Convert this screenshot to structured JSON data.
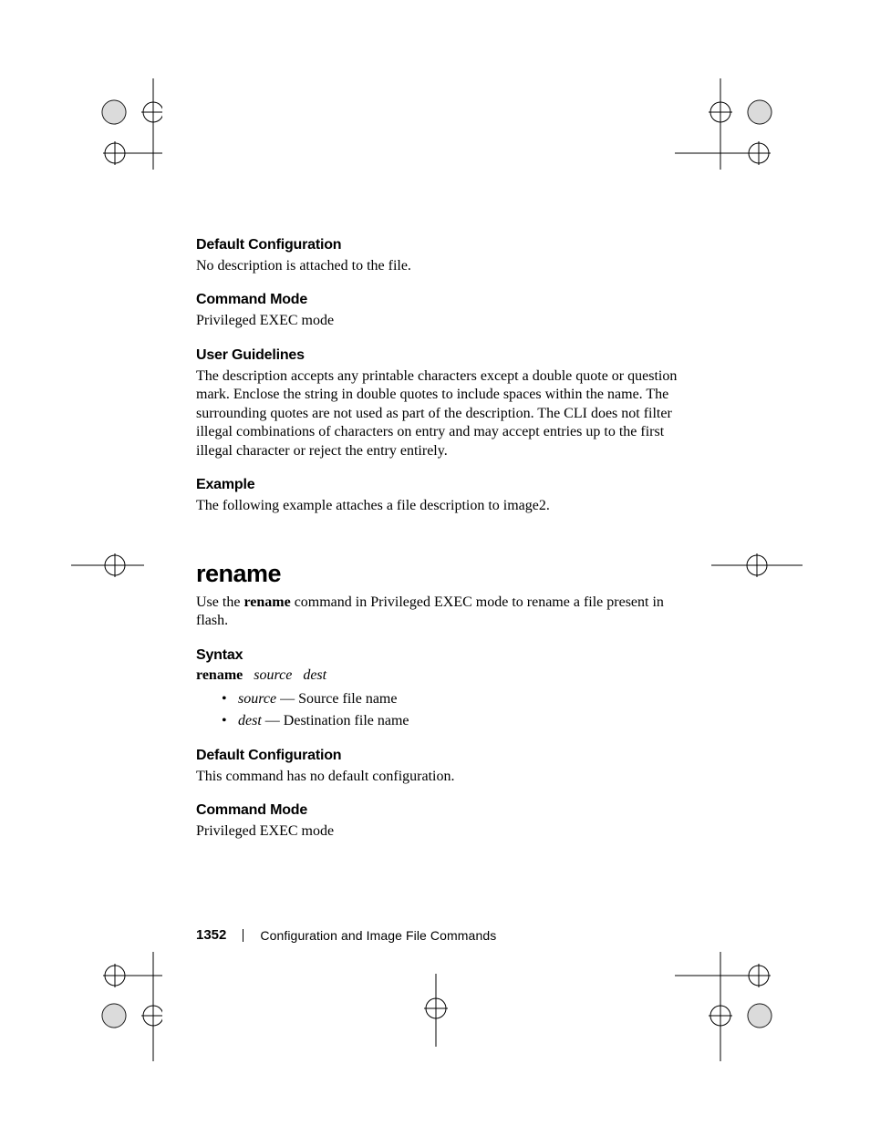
{
  "sections": {
    "defcfg1_h": "Default Configuration",
    "defcfg1_b": "No description is attached to the file.",
    "cmdmode1_h": "Command Mode",
    "cmdmode1_b": "Privileged EXEC mode",
    "userguide_h": "User Guidelines",
    "userguide_b": "The description accepts any printable characters except a double quote or question mark. Enclose the string in double quotes to include spaces within the name. The surrounding quotes are not used as part of the description. The CLI does not filter illegal combinations of characters on entry and may accept entries up to the first illegal character or reject the entry entirely.",
    "example_h": "Example",
    "example_b": "The following example attaches a file description to image2."
  },
  "rename": {
    "title": "rename",
    "intro_pre": "Use the ",
    "intro_cmd": "rename",
    "intro_post": " command in Privileged EXEC mode to rename a file present in flash.",
    "syntax_h": "Syntax",
    "syntax_cmd": "rename",
    "syntax_arg1": "source",
    "syntax_arg2": "dest",
    "bullet1_arg": "source",
    "bullet1_desc": " — Source file name",
    "bullet2_arg": "dest",
    "bullet2_desc": " — Destination file name",
    "defcfg_h": "Default Configuration",
    "defcfg_b": "This command has no default configuration.",
    "cmdmode_h": "Command Mode",
    "cmdmode_b": "Privileged EXEC mode"
  },
  "footer": {
    "page": "1352",
    "chapter": "Configuration and Image File Commands"
  }
}
